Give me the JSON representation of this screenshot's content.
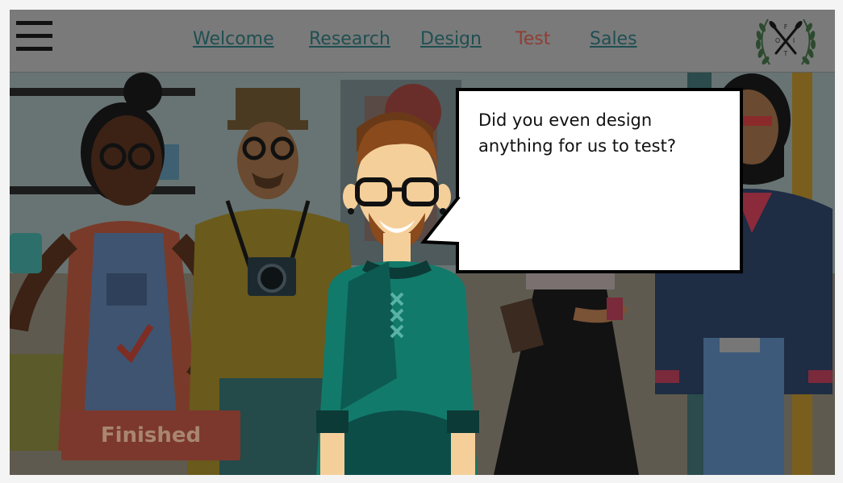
{
  "menu": {
    "icon": "hamburger-menu-icon"
  },
  "nav": {
    "items": [
      {
        "label": "Welcome",
        "state": "link"
      },
      {
        "label": "Research",
        "state": "link"
      },
      {
        "label": "Design",
        "state": "link"
      },
      {
        "label": "Test",
        "state": "active"
      },
      {
        "label": "Sales",
        "state": "link"
      }
    ]
  },
  "logo": {
    "letters": [
      "F",
      "O",
      "I",
      "T"
    ],
    "icon": "crossed-oars-laurel-logo"
  },
  "dialog": {
    "text": "Did you even design anything for us to test?"
  },
  "actions": {
    "finished_label": "Finished"
  },
  "colors": {
    "nav_link": "#1f4f52",
    "nav_active": "#8e3e33",
    "button_bg": "#7c382d",
    "button_text": "#a9866f"
  }
}
